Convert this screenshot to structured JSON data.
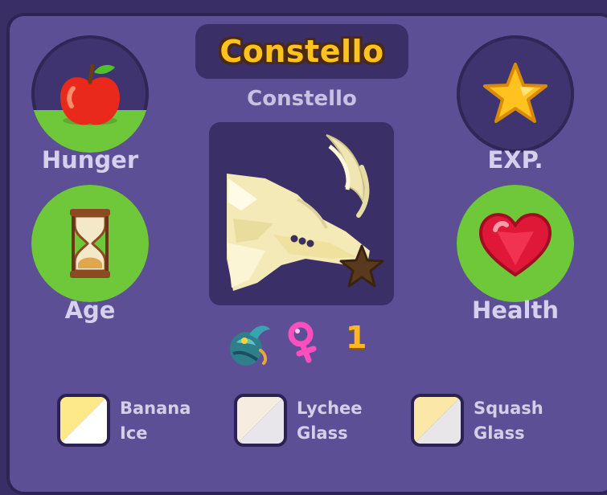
{
  "pet": {
    "title": "Constello",
    "species": "Constello",
    "level": "1"
  },
  "stats": {
    "hunger": {
      "label": "Hunger",
      "icon": "apple-icon",
      "fill": 0.36
    },
    "exp": {
      "label": "EXP.",
      "icon": "star-icon",
      "fill": 0
    },
    "age": {
      "label": "Age",
      "icon": "hourglass-icon",
      "fill": 1.0
    },
    "health": {
      "label": "Health",
      "icon": "heart-icon",
      "fill": 1.0
    }
  },
  "traits": {
    "element_icon": "dragon-egg-icon",
    "gender_icon": "female-icon"
  },
  "colors": {
    "fill_green": "#6fc83a",
    "title_gold": "#ffc21f",
    "panel": "#5d4f95"
  },
  "swatches": [
    {
      "line1": "Banana",
      "line2": "Ice",
      "color_a": "#fde98a",
      "color_b": "#ffffff"
    },
    {
      "line1": "Lychee",
      "line2": "Glass",
      "color_a": "#f6ede0",
      "color_b": "#e8e6ea"
    },
    {
      "line1": "Squash",
      "line2": "Glass",
      "color_a": "#fbe7a8",
      "color_b": "#e9e6ea"
    }
  ]
}
